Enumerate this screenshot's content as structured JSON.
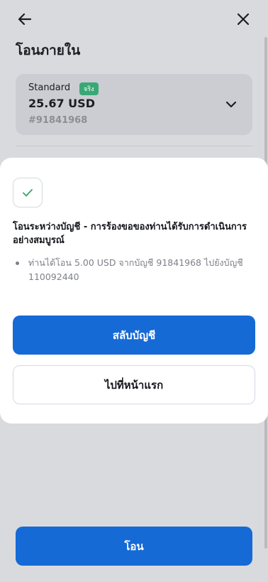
{
  "header": {
    "title": "โอนภายใน",
    "back_icon": "arrow-left-icon",
    "close_icon": "close-icon"
  },
  "account": {
    "type": "Standard",
    "badge": "จริง",
    "balance": "25.67 USD",
    "number": "#91841968"
  },
  "modal": {
    "title": "โอนระหว่างบัญชี - การร้องขอของท่านได้รับการดำเนินการอย่างสมบูรณ์",
    "detail": "ท่านได้โอน 5.00 USD จากบัญชี 91841968 ไปยังบัญชี 110092440",
    "switch_label": "สลับบัญชี",
    "home_label": "ไปที่หน้าแรก"
  },
  "footer": {
    "transfer_label": "โอน"
  },
  "colors": {
    "primary": "#156ad6",
    "badge": "#3aa876",
    "check": "#2fa866"
  }
}
